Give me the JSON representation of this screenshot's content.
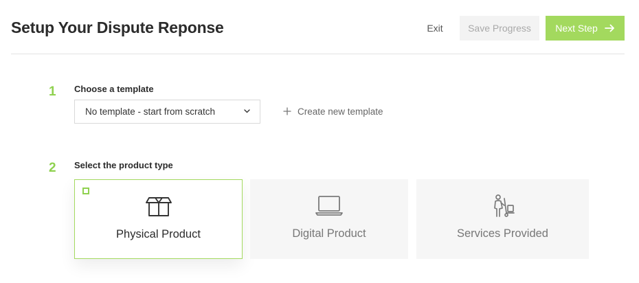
{
  "header": {
    "title": "Setup Your Dispute Reponse",
    "exit_label": "Exit",
    "save_label": "Save Progress",
    "next_label": "Next Step"
  },
  "steps": [
    {
      "number": "1",
      "label": "Choose a template",
      "select_value": "No template - start from scratch",
      "create_label": "Create new template"
    },
    {
      "number": "2",
      "label": "Select the product type",
      "options": [
        {
          "label": "Physical Product",
          "icon": "box-icon",
          "selected": true
        },
        {
          "label": "Digital Product",
          "icon": "laptop-icon",
          "selected": false
        },
        {
          "label": "Services Provided",
          "icon": "delivery-person-icon",
          "selected": false
        }
      ]
    }
  ],
  "colors": {
    "accent": "#a3d95e",
    "step_number": "#8fd14f",
    "disabled_bg": "#f3f3f3",
    "card_bg": "#f6f6f6"
  }
}
